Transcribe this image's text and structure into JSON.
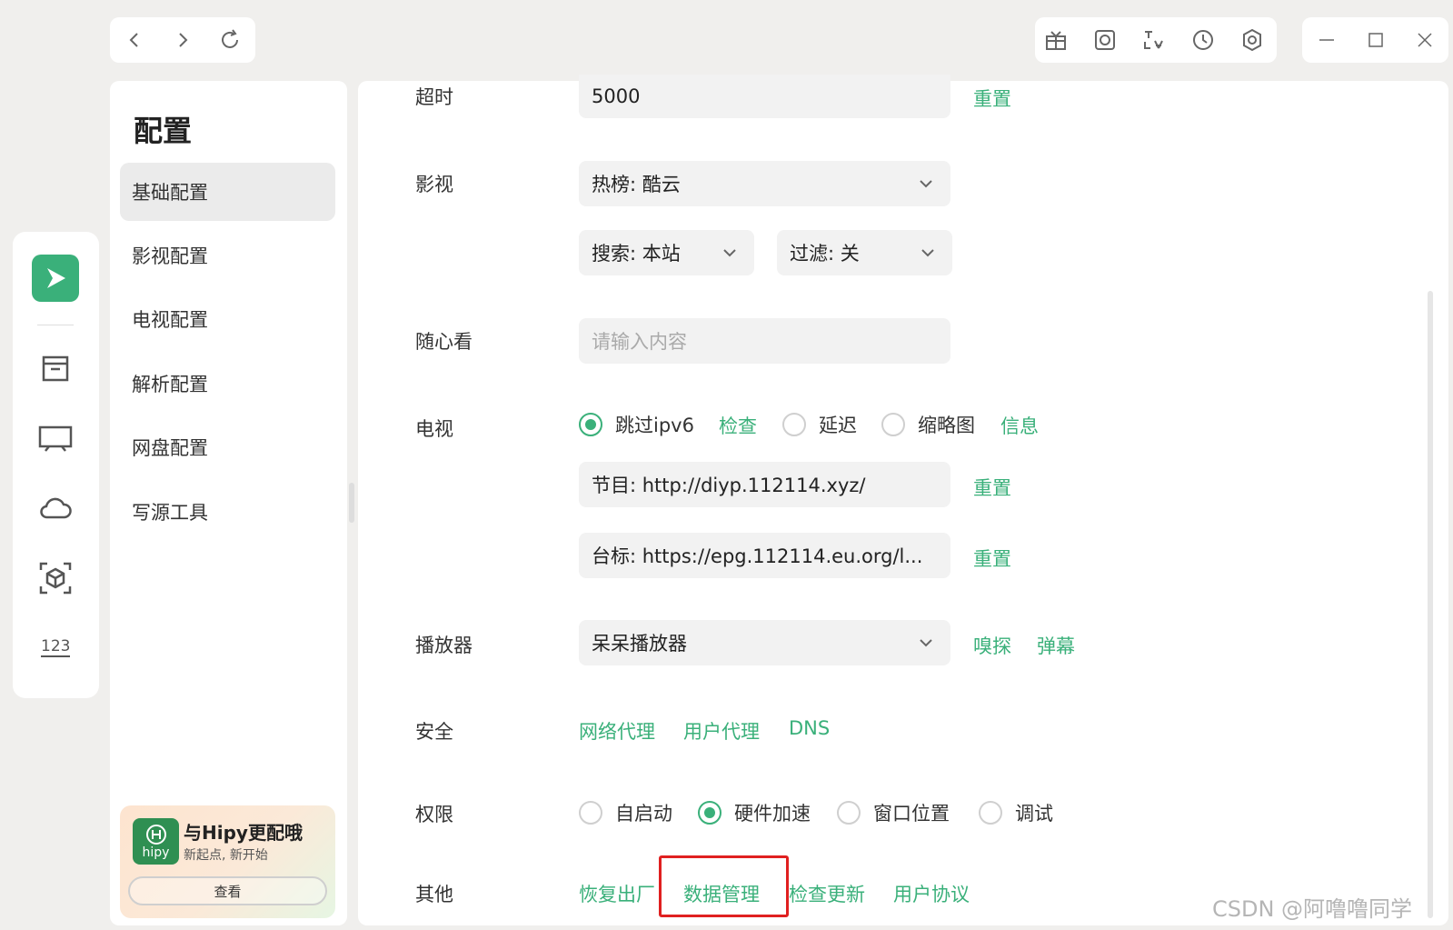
{
  "window": {
    "title": "配置"
  },
  "sidebar": {
    "items": [
      {
        "label": "基础配置"
      },
      {
        "label": "影视配置"
      },
      {
        "label": "电视配置"
      },
      {
        "label": "解析配置"
      },
      {
        "label": "网盘配置"
      },
      {
        "label": "写源工具"
      }
    ],
    "promo": {
      "title": "与Hipy更配哦",
      "subtitle": "新起点, 新开始",
      "logo_text": "hipy",
      "button": "查看"
    }
  },
  "settings": {
    "timeout": {
      "label": "超时",
      "value": "5000",
      "reset": "重置"
    },
    "video": {
      "label": "影视",
      "hot": "热榜: 酷云",
      "search": "搜索: 本站",
      "filter": "过滤: 关"
    },
    "random": {
      "label": "随心看",
      "placeholder": "请输入内容"
    },
    "tv": {
      "label": "电视",
      "skip_ipv6": "跳过ipv6",
      "check": "检查",
      "delay": "延迟",
      "thumbnail": "缩略图",
      "info": "信息",
      "program": "节目: http://diyp.112114.xyz/",
      "program_reset": "重置",
      "logo": "台标: https://epg.112114.eu.org/l...",
      "logo_reset": "重置"
    },
    "player": {
      "label": "播放器",
      "value": "呆呆播放器",
      "sniff": "嗅探",
      "danmaku": "弹幕"
    },
    "security": {
      "label": "安全",
      "proxy": "网络代理",
      "user_agent": "用户代理",
      "dns": "DNS"
    },
    "permission": {
      "label": "权限",
      "autostart": "自启动",
      "hw_accel": "硬件加速",
      "window_pos": "窗口位置",
      "debug": "调试"
    },
    "other": {
      "label": "其他",
      "restore": "恢复出厂",
      "data_manage": "数据管理",
      "check_update": "检查更新",
      "user_agreement": "用户协议"
    }
  },
  "watermark": "CSDN @阿噜噜同学",
  "colors": {
    "accent": "#3ab07a",
    "highlight_box": "#e02020"
  }
}
